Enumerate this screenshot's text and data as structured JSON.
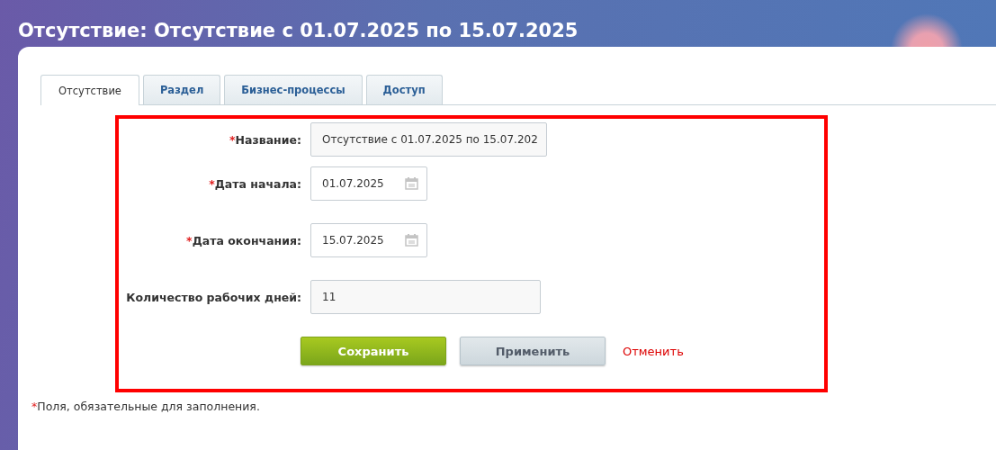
{
  "page_title": "Отсутствие: Отсутствие с 01.07.2025 по 15.07.2025",
  "tabs": [
    {
      "label": "Отсутствие",
      "selected": true
    },
    {
      "label": "Раздел",
      "selected": false
    },
    {
      "label": "Бизнес-процессы",
      "selected": false
    },
    {
      "label": "Доступ",
      "selected": false
    }
  ],
  "fields": [
    {
      "kind": "text",
      "required_mark": "*",
      "label": "Название:",
      "value": "Отсутствие с 01.07.2025 по 15.07.202"
    },
    {
      "kind": "date",
      "required_mark": "*",
      "label": "Дата начала:",
      "value": "01.07.2025"
    },
    {
      "kind": "date",
      "required_mark": "*",
      "label": "Дата окончания:",
      "value": "15.07.2025"
    },
    {
      "kind": "text",
      "label": "Количество рабочих дней:",
      "value": "11"
    }
  ],
  "buttons": [
    {
      "kind": "primary",
      "label": "Сохранить"
    },
    {
      "kind": "secondary",
      "label": "Применить"
    },
    {
      "kind": "link",
      "label": "Отменить"
    }
  ],
  "footnote": {
    "mark": "*",
    "text": "Поля, обязательные для заполнения."
  }
}
